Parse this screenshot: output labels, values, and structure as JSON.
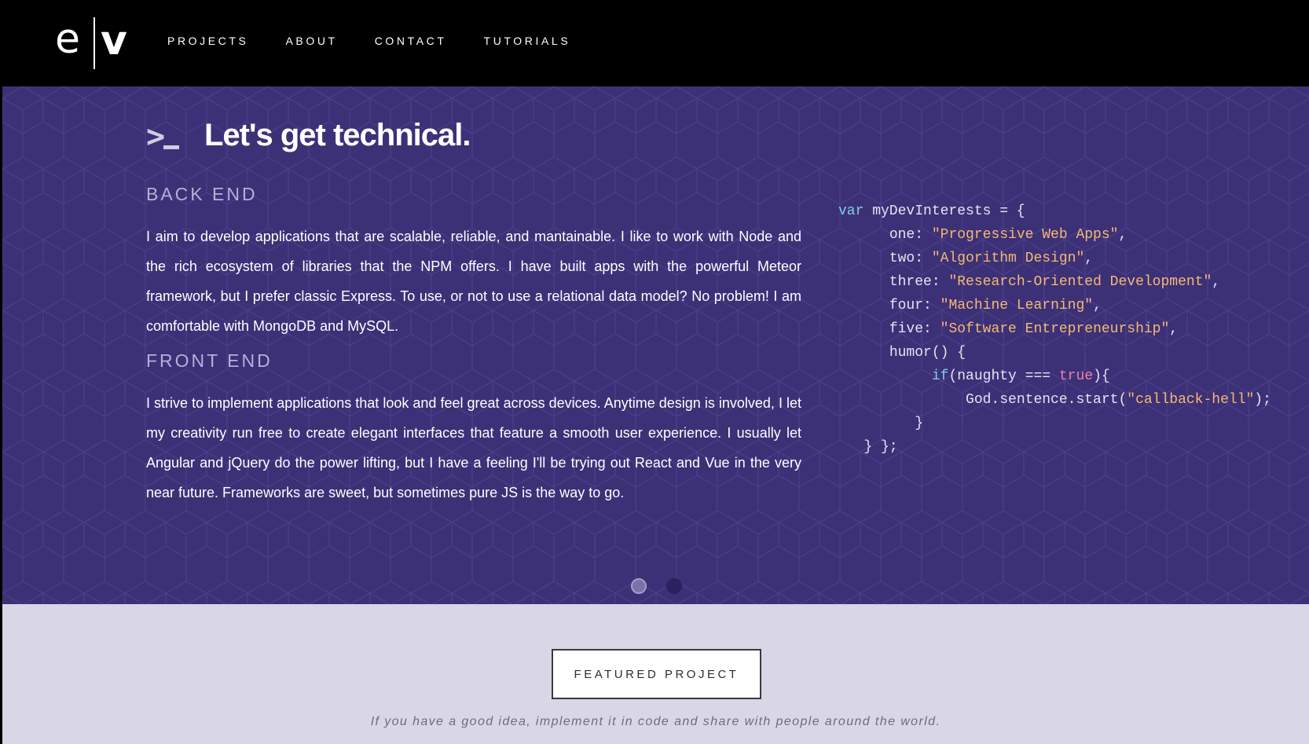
{
  "logo": {
    "left_letter": "e",
    "right_letter": "v"
  },
  "nav": {
    "items": [
      {
        "label": "PROJECTS"
      },
      {
        "label": "ABOUT"
      },
      {
        "label": "CONTACT"
      },
      {
        "label": "TUTORIALS"
      }
    ]
  },
  "tech": {
    "icon": "terminal-prompt-icon",
    "title": "Let's get technical.",
    "backend": {
      "heading": "BACK END",
      "text": "I aim to develop applications that are scalable, reliable, and mantainable. I like to work with Node and the rich ecosystem of libraries that the NPM offers. I have built apps with the powerful Meteor framework, but I prefer classic Express. To use, or not to use a relational data model? No problem! I am comfortable with MongoDB and MySQL."
    },
    "frontend": {
      "heading": "FRONT END",
      "text": "I strive to implement applications that look and feel great across devices. Anytime design is involved, I let my creativity run free to create elegant interfaces that feature a smooth user experience. I usually let Angular and jQuery do the power lifting, but I have a feeling I'll be trying out React and Vue in the very near future. Frameworks are sweet, but sometimes pure JS is the way to go."
    },
    "code": {
      "var_keyword": "var",
      "var_name": " myDevInterests = {",
      "entries": [
        {
          "key": "one",
          "value": "\"Progressive Web Apps\""
        },
        {
          "key": "two",
          "value": "\"Algorithm Design\""
        },
        {
          "key": "three",
          "value": "\"Research-Oriented Development\""
        },
        {
          "key": "four",
          "value": "\"Machine Learning\""
        },
        {
          "key": "five",
          "value": "\"Software Entrepreneurship\""
        }
      ],
      "humor_line": "humor() {",
      "if_keyword": "if",
      "if_cond": "(naughty === ",
      "true_keyword": "true",
      "if_close": "){",
      "call_prefix": "God.sentence.start(",
      "call_arg": "\"callback-hell\"",
      "call_suffix": ");",
      "close_inner": "}",
      "close_outer": "} };"
    },
    "carousel": {
      "count": 2,
      "active_index": 0
    }
  },
  "featured": {
    "button_label": "FEATURED PROJECT",
    "tagline": "If you have a good idea, implement it in code and share with people around the world."
  },
  "colors": {
    "navbar_bg": "#000000",
    "tech_bg": "#3c3177",
    "featured_bg": "#d9d6e6",
    "code_keyword": "#7fcfe0",
    "code_string": "#f6b873",
    "code_boolean": "#f27eb0"
  }
}
